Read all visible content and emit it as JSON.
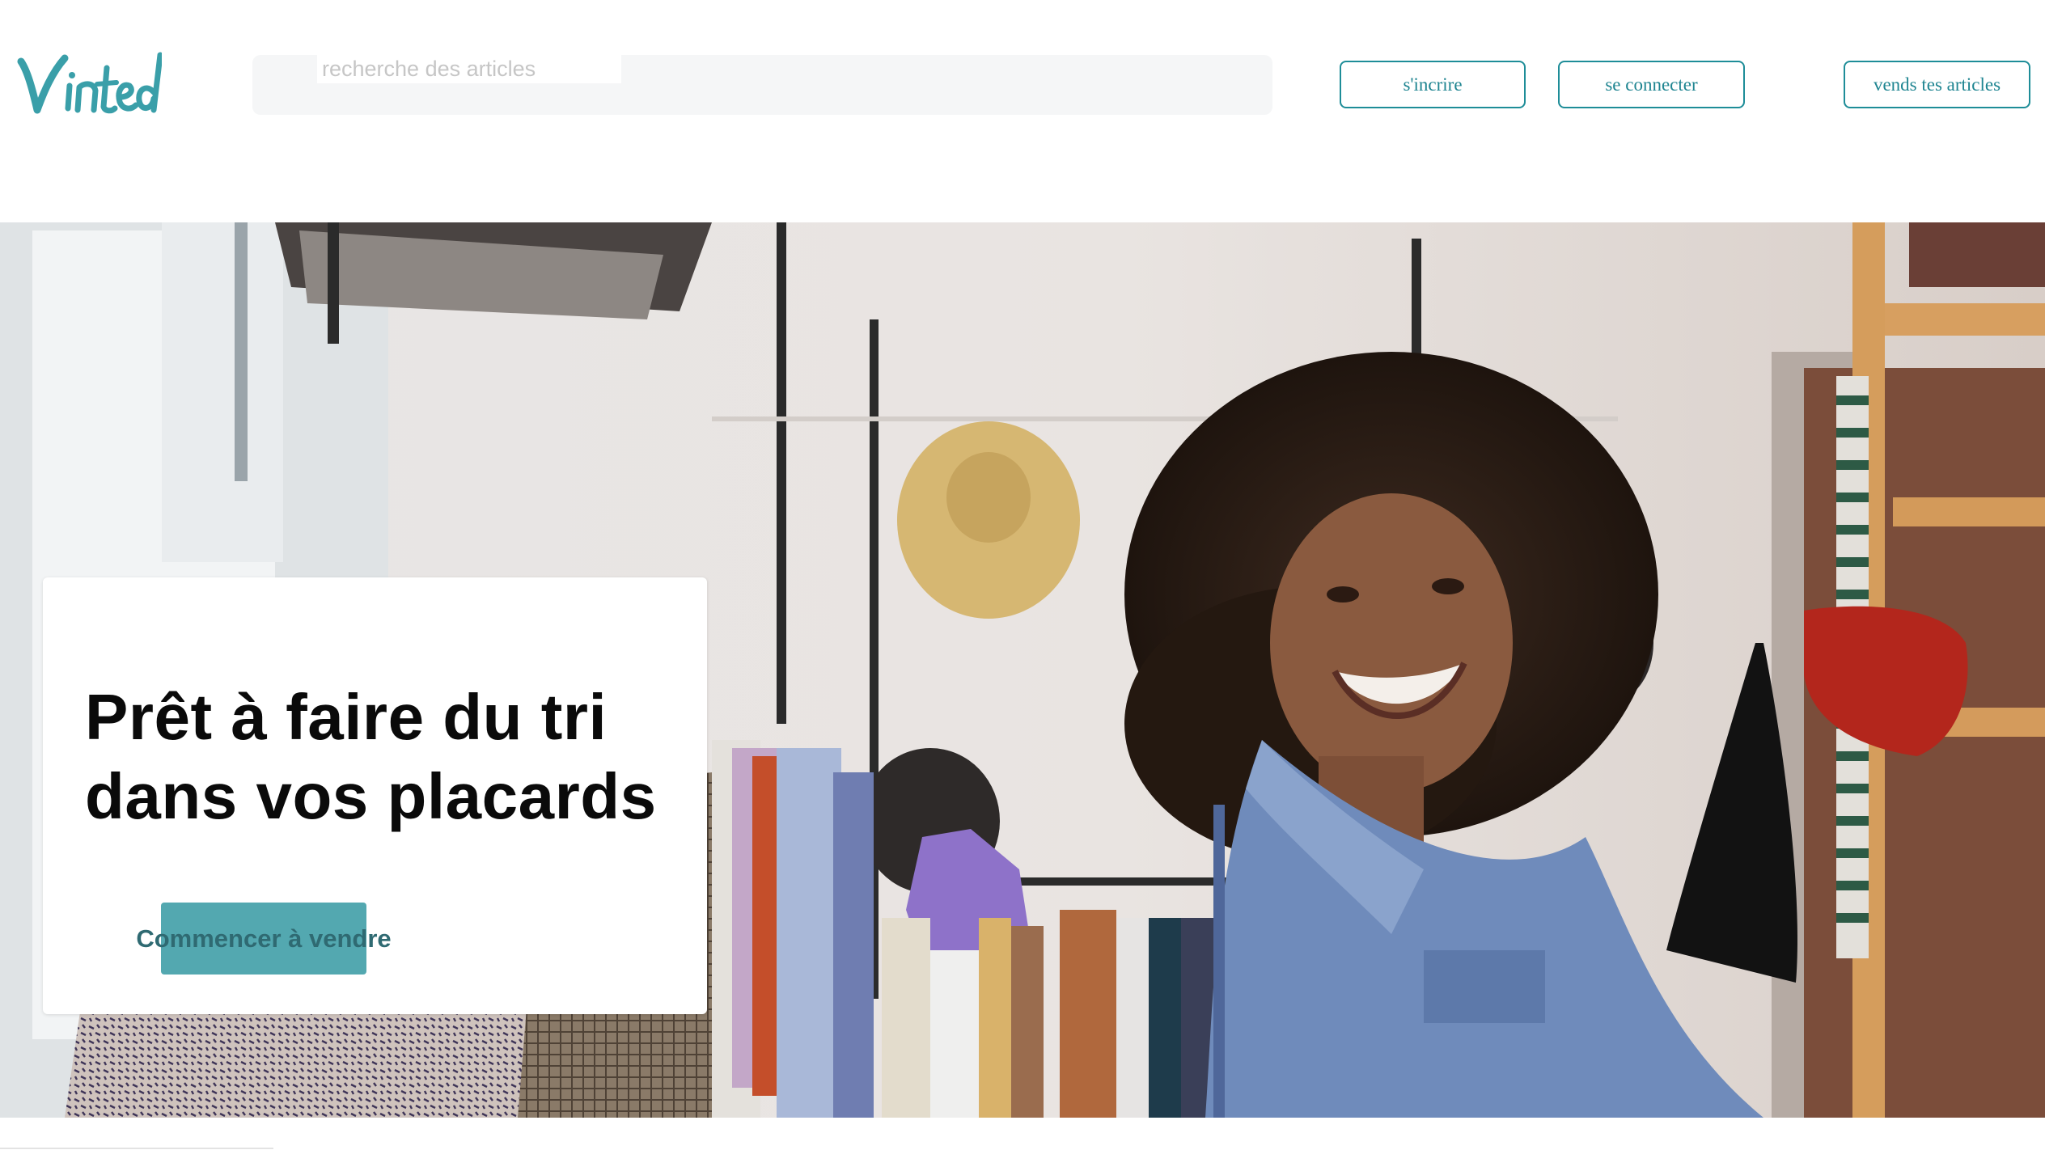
{
  "header": {
    "logo_text": "Vinted",
    "search": {
      "placeholder": "recherche des articles",
      "value": ""
    },
    "buttons": {
      "signup_label": "s'incrire",
      "login_label": "se connecter",
      "sell_label": "vends tes articles"
    }
  },
  "hero": {
    "title": "Prêt à faire du tri dans vos placards",
    "cta_label": "Commencer à vendre",
    "image_icon": "hero-photo"
  },
  "colors": {
    "brand": "#1e8d98",
    "cta_background": "#53a8b0",
    "cta_text": "#2f6a72",
    "search_background": "#f5f6f7"
  }
}
